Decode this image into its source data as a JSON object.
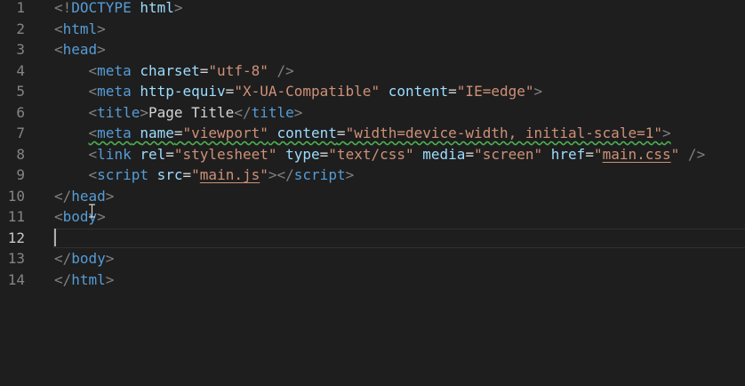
{
  "editor": {
    "lines": [
      {
        "num": "1",
        "indent": "",
        "tokens": [
          {
            "t": "<!",
            "c": "punct"
          },
          {
            "t": "DOCTYPE",
            "c": "tag"
          },
          {
            "t": " ",
            "c": "txt"
          },
          {
            "t": "html",
            "c": "attr"
          },
          {
            "t": ">",
            "c": "punct"
          }
        ]
      },
      {
        "num": "2",
        "indent": "",
        "tokens": [
          {
            "t": "<",
            "c": "punct"
          },
          {
            "t": "html",
            "c": "tag"
          },
          {
            "t": ">",
            "c": "punct"
          }
        ]
      },
      {
        "num": "3",
        "indent": "",
        "tokens": [
          {
            "t": "<",
            "c": "punct"
          },
          {
            "t": "head",
            "c": "tag"
          },
          {
            "t": ">",
            "c": "punct"
          }
        ]
      },
      {
        "num": "4",
        "indent": "    ",
        "tokens": [
          {
            "t": "<",
            "c": "punct"
          },
          {
            "t": "meta",
            "c": "tag"
          },
          {
            "t": " ",
            "c": "txt"
          },
          {
            "t": "charset",
            "c": "attr"
          },
          {
            "t": "=",
            "c": "eq"
          },
          {
            "t": "\"utf-8\"",
            "c": "str"
          },
          {
            "t": " />",
            "c": "punct"
          }
        ]
      },
      {
        "num": "5",
        "indent": "    ",
        "tokens": [
          {
            "t": "<",
            "c": "punct"
          },
          {
            "t": "meta",
            "c": "tag"
          },
          {
            "t": " ",
            "c": "txt"
          },
          {
            "t": "http-equiv",
            "c": "attr"
          },
          {
            "t": "=",
            "c": "eq"
          },
          {
            "t": "\"X-UA-Compatible\"",
            "c": "str"
          },
          {
            "t": " ",
            "c": "txt"
          },
          {
            "t": "content",
            "c": "attr"
          },
          {
            "t": "=",
            "c": "eq"
          },
          {
            "t": "\"IE=edge\"",
            "c": "str"
          },
          {
            "t": ">",
            "c": "punct"
          }
        ]
      },
      {
        "num": "6",
        "indent": "    ",
        "tokens": [
          {
            "t": "<",
            "c": "punct"
          },
          {
            "t": "title",
            "c": "tag"
          },
          {
            "t": ">",
            "c": "punct"
          },
          {
            "t": "Page Title",
            "c": "txt"
          },
          {
            "t": "</",
            "c": "punct"
          },
          {
            "t": "title",
            "c": "tag"
          },
          {
            "t": ">",
            "c": "punct"
          }
        ]
      },
      {
        "num": "7",
        "indent": "    ",
        "squiggle": true,
        "tokens": [
          {
            "t": "<",
            "c": "punct"
          },
          {
            "t": "meta",
            "c": "tag"
          },
          {
            "t": " ",
            "c": "txt"
          },
          {
            "t": "name",
            "c": "attr"
          },
          {
            "t": "=",
            "c": "eq"
          },
          {
            "t": "\"viewport\"",
            "c": "str"
          },
          {
            "t": " ",
            "c": "txt"
          },
          {
            "t": "content",
            "c": "attr"
          },
          {
            "t": "=",
            "c": "eq"
          },
          {
            "t": "\"width=device-width, initial-scale=1\"",
            "c": "str"
          },
          {
            "t": ">",
            "c": "punct"
          }
        ]
      },
      {
        "num": "8",
        "indent": "    ",
        "tokens": [
          {
            "t": "<",
            "c": "punct"
          },
          {
            "t": "link",
            "c": "tag"
          },
          {
            "t": " ",
            "c": "txt"
          },
          {
            "t": "rel",
            "c": "attr"
          },
          {
            "t": "=",
            "c": "eq"
          },
          {
            "t": "\"stylesheet\"",
            "c": "str"
          },
          {
            "t": " ",
            "c": "txt"
          },
          {
            "t": "type",
            "c": "attr"
          },
          {
            "t": "=",
            "c": "eq"
          },
          {
            "t": "\"text/css\"",
            "c": "str"
          },
          {
            "t": " ",
            "c": "txt"
          },
          {
            "t": "media",
            "c": "attr"
          },
          {
            "t": "=",
            "c": "eq"
          },
          {
            "t": "\"screen\"",
            "c": "str"
          },
          {
            "t": " ",
            "c": "txt"
          },
          {
            "t": "href",
            "c": "attr"
          },
          {
            "t": "=",
            "c": "eq"
          },
          {
            "t": "\"",
            "c": "str"
          },
          {
            "t": "main.css",
            "c": "str",
            "link": true
          },
          {
            "t": "\"",
            "c": "str"
          },
          {
            "t": " />",
            "c": "punct"
          }
        ]
      },
      {
        "num": "9",
        "indent": "    ",
        "tokens": [
          {
            "t": "<",
            "c": "punct"
          },
          {
            "t": "script",
            "c": "tag"
          },
          {
            "t": " ",
            "c": "txt"
          },
          {
            "t": "src",
            "c": "attr"
          },
          {
            "t": "=",
            "c": "eq"
          },
          {
            "t": "\"",
            "c": "str"
          },
          {
            "t": "main.js",
            "c": "str",
            "link": true
          },
          {
            "t": "\"",
            "c": "str"
          },
          {
            "t": "></",
            "c": "punct"
          },
          {
            "t": "script",
            "c": "tag"
          },
          {
            "t": ">",
            "c": "punct"
          }
        ]
      },
      {
        "num": "10",
        "indent": "",
        "tokens": [
          {
            "t": "</",
            "c": "punct"
          },
          {
            "t": "head",
            "c": "tag"
          },
          {
            "t": ">",
            "c": "punct"
          }
        ]
      },
      {
        "num": "11",
        "indent": "",
        "tokens": [
          {
            "t": "<",
            "c": "punct"
          },
          {
            "t": "body",
            "c": "tag"
          },
          {
            "t": ">",
            "c": "punct"
          }
        ]
      },
      {
        "num": "12",
        "indent": "",
        "active": true,
        "tokens": []
      },
      {
        "num": "13",
        "indent": "",
        "tokens": [
          {
            "t": "</",
            "c": "punct"
          },
          {
            "t": "body",
            "c": "tag"
          },
          {
            "t": ">",
            "c": "punct"
          }
        ]
      },
      {
        "num": "14",
        "indent": "",
        "tokens": [
          {
            "t": "</",
            "c": "punct"
          },
          {
            "t": "html",
            "c": "tag"
          },
          {
            "t": ">",
            "c": "punct"
          }
        ]
      }
    ]
  },
  "colors": {
    "background": "#1e1e1e",
    "line_number": "#858585",
    "tag": "#569cd6",
    "attribute": "#9cdcfe",
    "string": "#ce9178",
    "punctuation": "#808080",
    "text": "#d4d4d4",
    "squiggle": "#4caf50"
  },
  "icons": {
    "cursor": "i-beam-cursor-icon"
  }
}
